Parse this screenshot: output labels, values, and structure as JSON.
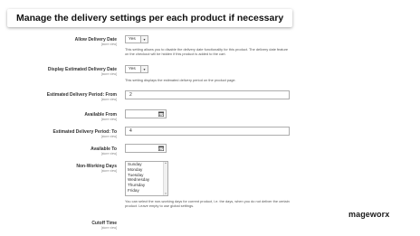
{
  "banner": {
    "title": "Manage the delivery settings per each product if necessary"
  },
  "scope_label": "[store view]",
  "fields": {
    "allow_delivery_date": {
      "label": "Allow Delivery Date",
      "value": "Yes",
      "note": "This setting allows you to disable the delivery date functionality for this product. The delivery date feature on the checkout will be hidden if this product is added to the cart."
    },
    "display_estimated": {
      "label": "Display Estimated Delivery Date",
      "value": "Yes",
      "note": "This setting displays the estimated delivery period on the product page."
    },
    "period_from": {
      "label": "Estimated Delivery Period: From",
      "value": "2"
    },
    "available_from": {
      "label": "Available From",
      "value": ""
    },
    "period_to": {
      "label": "Estimated Delivery Period: To",
      "value": "4"
    },
    "available_to": {
      "label": "Available To",
      "value": ""
    },
    "non_working_days": {
      "label": "Non-Working Days",
      "options": [
        "Sunday",
        "Monday",
        "Tuesday",
        "Wednesday",
        "Thursday",
        "Friday"
      ],
      "note": "You can select the non-working days for current product, i.e. the days, when you do not deliver the certain product. Leave empty to use global settings."
    },
    "cutoff_time": {
      "label": "Cutoff Time"
    }
  },
  "brand": {
    "logo_text": "mageworx"
  }
}
